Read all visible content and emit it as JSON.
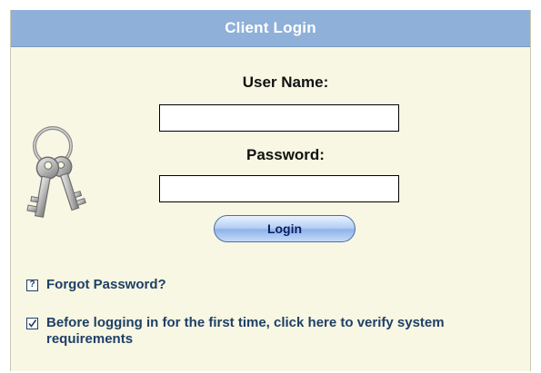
{
  "header": {
    "title": "Client Login"
  },
  "form": {
    "username_label": "User Name:",
    "username_value": "",
    "password_label": "Password:",
    "password_value": "",
    "login_label": "Login"
  },
  "links": {
    "forgot_password": "Forgot Password?",
    "verify_requirements": "Before logging in for the first time, click here to verify system requirements"
  },
  "icons": {
    "keys": "keys-icon",
    "forgot": "question-box-icon",
    "verify": "checkbox-check-icon"
  },
  "colors": {
    "header_bg": "#8fb0d8",
    "panel_bg": "#f7f7e3",
    "link_text": "#1f3f66",
    "button_text": "#0a1e63"
  }
}
